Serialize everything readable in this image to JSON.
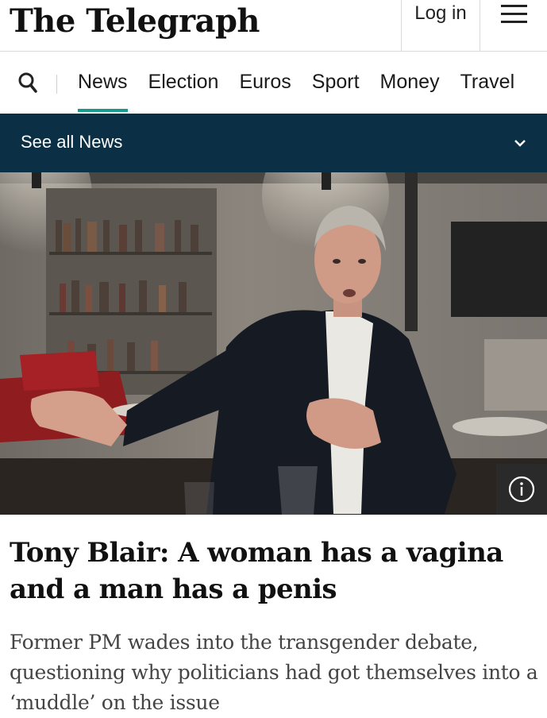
{
  "header": {
    "logo_text": "The Telegraph",
    "login_label": "Log in",
    "menu_icon": "hamburger-menu-icon"
  },
  "nav": {
    "search_icon": "search-icon",
    "items": [
      {
        "label": "News",
        "active": true
      },
      {
        "label": "Election"
      },
      {
        "label": "Euros"
      },
      {
        "label": "Sport"
      },
      {
        "label": "Money"
      },
      {
        "label": "Travel"
      }
    ]
  },
  "subnav": {
    "label": "See all News",
    "icon": "chevron-down-icon"
  },
  "hero": {
    "info_icon": "info-icon"
  },
  "article": {
    "headline": "Tony Blair: A woman has a vagina and a man has a penis",
    "standfirst": "Former PM wades into the transgender debate, questioning why politicians had got themselves into a ‘muddle’ on the issue"
  },
  "colors": {
    "subnav_bg": "#0b3045",
    "active_underline": "#1b9a8e"
  }
}
